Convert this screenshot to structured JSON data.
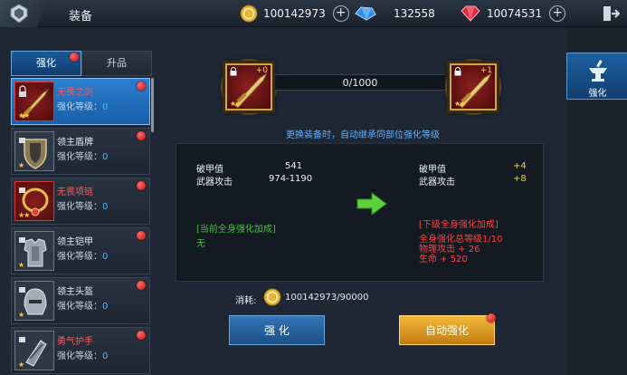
{
  "header": {
    "title": "装备",
    "gold": "100142973",
    "diamond": "132558",
    "ruby": "10074531"
  },
  "tabs": [
    {
      "label": "强化",
      "active": true,
      "badge": true
    },
    {
      "label": "升品",
      "active": false,
      "badge": false
    }
  ],
  "equipment": [
    {
      "name": "无畏之剑",
      "level_label": "强化等级：",
      "level": "0",
      "quality": "red",
      "selected": true
    },
    {
      "name": "领主盾牌",
      "level_label": "强化等级：",
      "level": "0",
      "quality": "gray",
      "selected": false
    },
    {
      "name": "无畏项链",
      "level_label": "强化等级：",
      "level": "0",
      "quality": "red",
      "selected": false
    },
    {
      "name": "领主铠甲",
      "level_label": "强化等级：",
      "level": "0",
      "quality": "gray",
      "selected": false
    },
    {
      "name": "领主头盔",
      "level_label": "强化等级：",
      "level": "0",
      "quality": "gray",
      "selected": false
    },
    {
      "name": "勇气护手",
      "level_label": "强化等级：",
      "level": "0",
      "quality": "gray",
      "selected": false
    }
  ],
  "side_tab": {
    "label": "强化"
  },
  "enhance": {
    "current_plus": "+0",
    "next_plus": "+1",
    "progress_text": "0/1000",
    "progress_fraction": 0,
    "hint": "更换装备时，自动继承同部位强化等级",
    "stats": [
      {
        "name": "破甲值",
        "value": "541",
        "increase": "+4"
      },
      {
        "name": "武器攻击",
        "value": "974-1190",
        "increase": "+8"
      }
    ],
    "current_bonus_title": "[当前全身强化加成]",
    "current_bonus_value": "无",
    "next_bonus_title": "[下级全身强化加成]",
    "next_bonus_lines": [
      "全身强化总等级1/10",
      "物理攻击 + 26",
      "生命 + 520"
    ],
    "cost_label": "消耗:",
    "cost_value": "100142973/90000",
    "enhance_button": "强 化",
    "auto_button": "自动强化"
  },
  "colors": {
    "accent_blue": "#1b5a9a",
    "gold": "#f3b93a",
    "red": "#ff4040",
    "green": "#3ac73a",
    "yellow": "#f1d62b"
  }
}
